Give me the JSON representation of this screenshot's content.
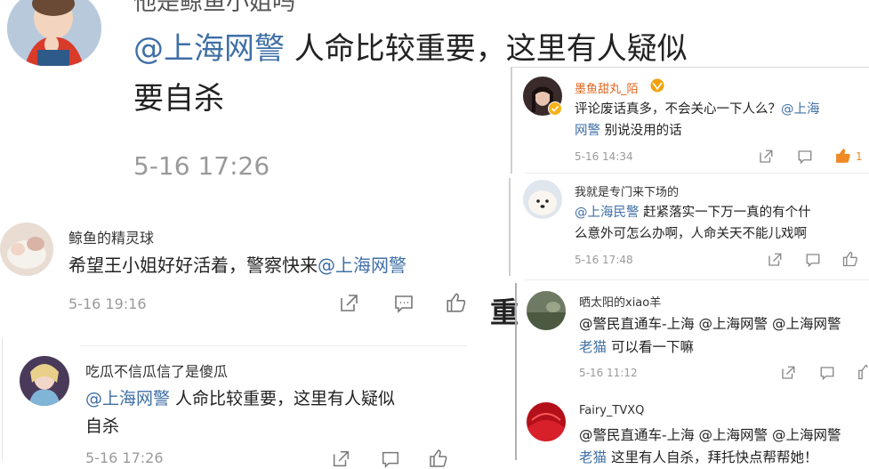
{
  "top_post": {
    "partial_name": "他是鲸鱼小姐吗",
    "mention": "@上海网警",
    "text_line1": " 人命比较重要，这里有人疑似",
    "text_line2": "要自杀",
    "time": "5-16 17:26"
  },
  "comment1": {
    "name": "鲸鱼的精灵球",
    "text": "希望王小姐好好活着，警察快来",
    "mention": "@上海网警",
    "time": "5-16 19:16"
  },
  "comment2": {
    "name": "吃瓜不信瓜信了是傻瓜",
    "mention": "@上海网警",
    "text_line1": " 人命比较重要，这里有人疑似",
    "text_line2": "自杀",
    "time": "5-16 17:26"
  },
  "right1": {
    "name": "墨鱼甜丸_陌",
    "text_a": "评论废话真多，不会关心一下人么？",
    "mention_a": "@上海",
    "mention_b": "网警",
    "text_b": " 别说没用的话",
    "time": "5-16 14:34",
    "like_count": "1"
  },
  "right2": {
    "name": "我就是专门来下场的",
    "mention": "@上海民警",
    "text_a": " 赶紧落实一下万一真的有个什",
    "text_b": "么意外可怎么办啊，人命关天不能儿戏啊",
    "time": "5-16 17:48"
  },
  "right3": {
    "name": "晒太阳的xiao羊",
    "mentions": "@警民直通车-上海 @上海网警 @上海网警",
    "mention_b": "老猫",
    "text_b": " 可以看一下嘛",
    "time": "5-16 11:12"
  },
  "right4": {
    "name": "Fairy_TVXQ",
    "mentions": "@警民直通车-上海 @上海网警 @上海网警",
    "mention_b": "老猫",
    "text_b": " 这里有人自杀，拜托快点帮帮她！"
  },
  "stray_char": "重",
  "icons": [
    "share-icon",
    "comment-icon",
    "like-icon"
  ],
  "colors": {
    "mention": "#3f6fa6",
    "like_active": "#f08a24",
    "time": "#9a9a9a"
  }
}
